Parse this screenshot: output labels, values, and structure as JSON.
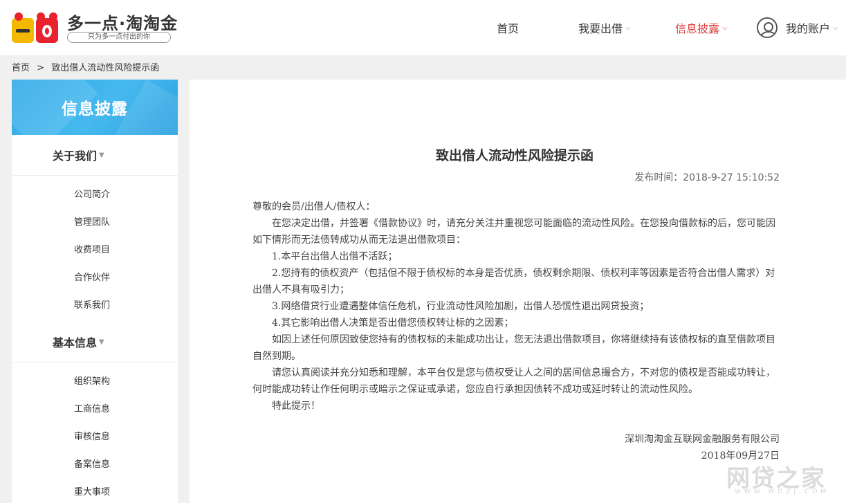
{
  "header": {
    "logo_title": "多一点·淘淘金",
    "logo_slogan": "只为多一点付出的你",
    "nav": {
      "home": "首页",
      "invest": "我要出借",
      "disclosure": "信息披露",
      "account": "我的账户"
    }
  },
  "breadcrumb": {
    "home": "首页",
    "separator": ">",
    "current": "致出借人流动性风险提示函"
  },
  "sidebar": {
    "banner": "信息披露",
    "sections": [
      {
        "title": "关于我们",
        "items": [
          "公司简介",
          "管理团队",
          "收费项目",
          "合作伙伴",
          "联系我们"
        ]
      },
      {
        "title": "基本信息",
        "items": [
          "组织架构",
          "工商信息",
          "审核信息",
          "备案信息",
          "重大事项"
        ]
      }
    ]
  },
  "article": {
    "title": "致出借人流动性风险提示函",
    "publish_time": "发布时间：2018-9-27 15:10:52",
    "salutation": "尊敬的会员/出借人/债权人：",
    "paragraphs": [
      "在您决定出借，并签署《借款协议》时，请充分关注并重视您可能面临的流动性风险。在您投向借款标的后，您可能因如下情形而无法债转成功从而无法退出借款项目：",
      "1.本平台出借人出借不活跃；",
      "2.您持有的债权资产（包括但不限于债权标的本身是否优质，债权剩余期限、债权利率等因素是否符合出借人需求）对出借人不具有吸引力；",
      "3.网络借贷行业遭遇整体信任危机，行业流动性风险加剧，出借人恐慌性退出网贷投资；",
      "4.其它影响出借人决策是否出借您债权转让标的之因素；",
      "如因上述任何原因致使您持有的债权标的未能成功出让，您无法退出借款项目，你将继续持有该债权标的直至借款项目自然到期。",
      "请您认真阅读并充分知悉和理解，本平台仅是您与债权受让人之间的居间信息撮合方，不对您的债权是否能成功转让，何时能成功转让作任何明示或暗示之保证或承诺，您应自行承担因债转不成功或延时转让的流动性风险。",
      "特此提示！"
    ],
    "signature_company": "深圳淘淘金互联网金融服务有限公司",
    "signature_date": "2018年09月27日"
  },
  "watermark": {
    "text": "网贷之家",
    "sub": "WWW.WDZJ.COM"
  },
  "colors": {
    "accent_red": "#e33b3b",
    "banner_blue": "#2ea8e6",
    "logo_yellow": "#f5b800",
    "logo_red": "#e8232d"
  },
  "icons": {
    "account": "user-circle-icon",
    "caret": "chevron-down-icon"
  }
}
